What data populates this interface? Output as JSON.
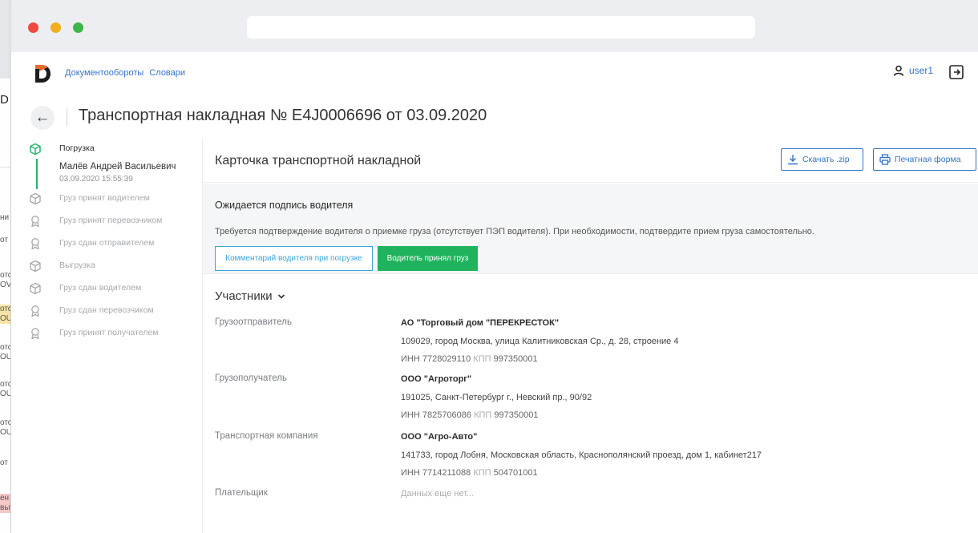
{
  "background_window": {
    "letter": "D",
    "chips": [
      "ни",
      "от",
      "отс",
      "OV",
      "отс",
      "OU",
      "отс",
      "OU",
      "отс",
      "OU",
      "отс",
      "OU",
      "от",
      "ен",
      "вы"
    ]
  },
  "header": {
    "nav": [
      "Документообороты",
      "Словари"
    ],
    "user": "user1"
  },
  "page": {
    "title": "Транспортная накладная № E4J0006696 от 03.09.2020"
  },
  "timeline": {
    "active": {
      "label": "Погрузка",
      "person": "Малёв Андрей Васильевич",
      "date": "03.09.2020 15:55:39"
    },
    "steps": [
      {
        "label": "Груз принят водителем",
        "icon": "box-icon"
      },
      {
        "label": "Груз принят перевозчиком",
        "icon": "badge-icon"
      },
      {
        "label": "Груз сдан отправителем",
        "icon": "badge-icon"
      },
      {
        "label": "Выгрузка",
        "icon": "box-icon"
      },
      {
        "label": "Груз сдан водителем",
        "icon": "box-icon"
      },
      {
        "label": "Груз сдан перевозчиком",
        "icon": "badge-icon"
      },
      {
        "label": "Груз принят получателем",
        "icon": "badge-icon"
      }
    ]
  },
  "card": {
    "title": "Карточка транспортной накладной",
    "download_label": "Скачать .zip",
    "print_label": "Печатная форма"
  },
  "notice": {
    "title": "Ожидается подпись водителя",
    "text": "Требуется подтверждение водителя о приемке груза (отсутствует ПЭП водителя). При необходимости, подтвердите прием груза самостоятельно.",
    "comment_button": "Комментарий водителя при погрузке",
    "accept_button": "Водитель принял груз"
  },
  "participants": {
    "title": "Участники",
    "shipper": {
      "role": "Грузоотправитель",
      "name": "АО \"Торговый дом \"ПЕРЕКРЕСТОК\"",
      "address": "109029, город Москва, улица Калитниковская Ср., д. 28, строение 4",
      "inn": "ИНН 7728029110",
      "kpp_label": "КПП",
      "kpp": "997350001"
    },
    "consignee": {
      "role": "Грузополучатель",
      "name": "ООО \"Агроторг\"",
      "address": "191025, Санкт-Петербург г., Невский пр., 90/92",
      "inn": "ИНН 7825706086",
      "kpp_label": "КПП",
      "kpp": "997350001"
    },
    "carrier": {
      "role": "Транспортная компания",
      "name": "ООО \"Агро-Авто\"",
      "address": "141733, город Лобня, Московская область, Краснополянский проезд, дом 1, кабинет217",
      "inn": "ИНН 7714211088",
      "kpp_label": "КПП",
      "kpp": "504701001"
    },
    "payer": {
      "role": "Плательщик",
      "empty": "Данных еще нет..."
    }
  },
  "colors": {
    "accent": "#3273c8",
    "success": "#1fb35d",
    "timeline_active": "#26b56b"
  }
}
